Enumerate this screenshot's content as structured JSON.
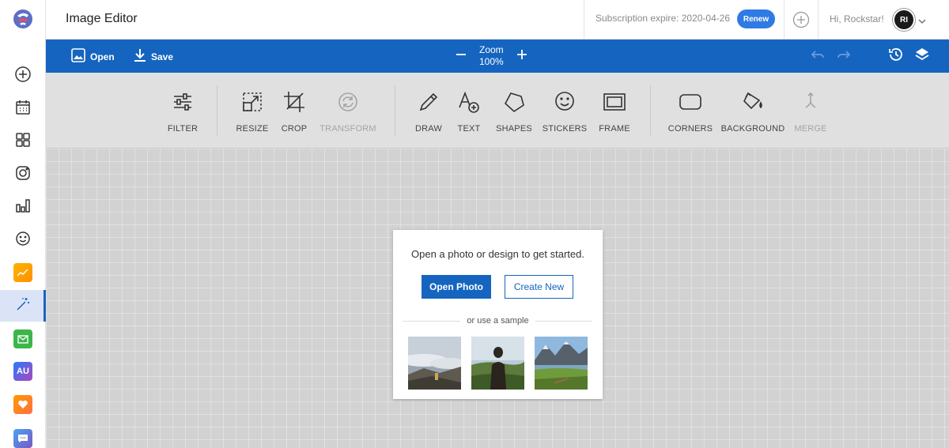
{
  "app": {
    "title": "Image Editor"
  },
  "header": {
    "subscription_text": "Subscription expire: 2020-04-26",
    "renew_label": "Renew",
    "greeting": "Hi, Rockstar!",
    "avatar_initials": "RI"
  },
  "toolbar": {
    "open_label": "Open",
    "save_label": "Save",
    "zoom_title": "Zoom",
    "zoom_value": "100%"
  },
  "tools": {
    "filter": "FILTER",
    "resize": "RESIZE",
    "crop": "CROP",
    "transform": "TRANSFORM",
    "draw": "DRAW",
    "text": "TEXT",
    "shapes": "SHAPES",
    "stickers": "STICKERS",
    "frame": "FRAME",
    "corners": "CORNERS",
    "background": "BACKGROUND",
    "merge": "MERGE"
  },
  "disabled_tools": [
    "TRANSFORM",
    "MERGE"
  ],
  "card": {
    "message": "Open a photo or design to get started.",
    "open_photo_label": "Open Photo",
    "create_new_label": "Create New",
    "sample_label": "or use a sample"
  },
  "sidebar": {
    "items": [
      {
        "icon": "plus-circle-icon"
      },
      {
        "icon": "calendar-icon"
      },
      {
        "icon": "grid-icon"
      },
      {
        "icon": "instagram-icon"
      },
      {
        "icon": "bar-chart-icon"
      },
      {
        "icon": "smiley-icon"
      },
      {
        "icon": "trend-icon"
      },
      {
        "icon": "magic-wand-icon",
        "active": true
      },
      {
        "icon": "mail-icon"
      },
      {
        "icon": "au-badge-icon",
        "label": "AU"
      },
      {
        "icon": "heart-icon"
      },
      {
        "icon": "chat-icon"
      }
    ]
  },
  "colors": {
    "brand_blue": "#1565c0",
    "renew_blue": "#2f7ae5",
    "tools_bg": "#e0e0e0",
    "canvas_bg": "#d2d2d2",
    "disabled_text": "#a4a4a4"
  }
}
